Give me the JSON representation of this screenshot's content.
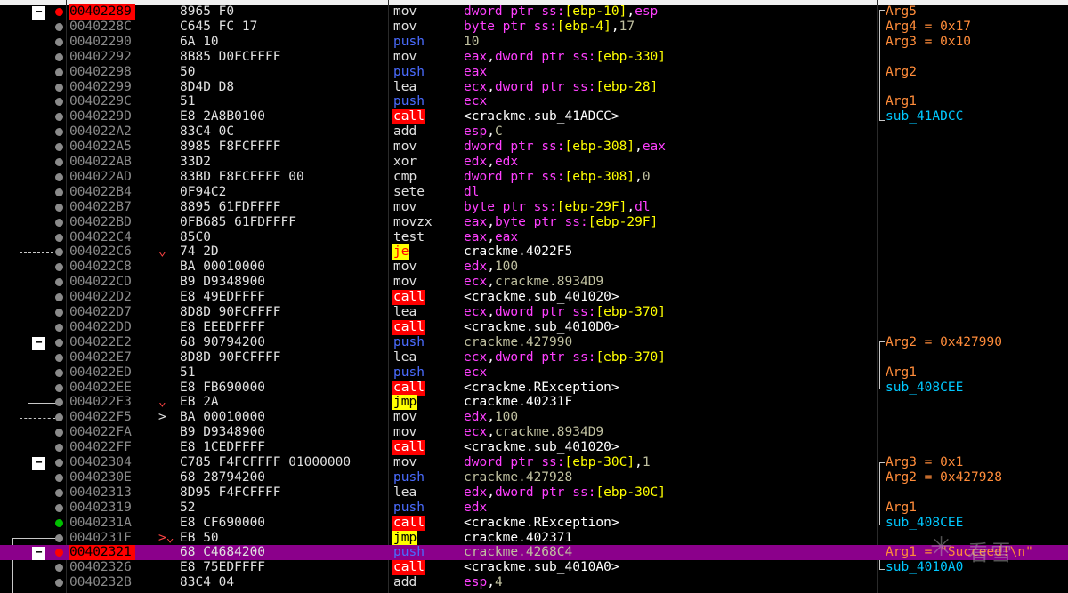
{
  "colors": {
    "background": "#000000",
    "address": "#8a8a8a",
    "eip_bg": "#ff0000",
    "call_bg": "#ff0000",
    "jmp_bg": "#ffff00",
    "push": "#4a6cff",
    "register": "#ff40ff",
    "ptr": "#ff40ff",
    "segment": "#ff40ff",
    "memory_bracket": "#ffff00",
    "immediate": "#c0c0a0",
    "label": "#ffffff",
    "comment_arg": "#ff8c3a",
    "comment_sub": "#00c8ff",
    "selected_row": "#8b008b"
  },
  "rows": [
    {
      "addr": "00402289",
      "bytes": "8965 F0",
      "mn": "mov",
      "op": [
        [
          "dword ptr ",
          "ptr"
        ],
        [
          "ss:",
          "seg"
        ],
        [
          "[ebp-10]",
          "mem"
        ],
        [
          ",",
          "sep"
        ],
        [
          "esp",
          "reg"
        ]
      ],
      "comment": "Arg5",
      "eip": true,
      "dot": "red",
      "collapse": true
    },
    {
      "addr": "0040228C",
      "bytes": "C645 FC 17",
      "mn": "mov",
      "op": [
        [
          "byte ptr ",
          "ptr"
        ],
        [
          "ss:",
          "seg"
        ],
        [
          "[ebp-4]",
          "mem"
        ],
        [
          ",",
          "sep"
        ],
        [
          "17",
          "imm"
        ]
      ],
      "comment": "Arg4 = 0x17"
    },
    {
      "addr": "00402290",
      "bytes": "6A 10",
      "mn": "push",
      "op": [
        [
          "10",
          "imm"
        ]
      ],
      "comment": "Arg3 = 0x10"
    },
    {
      "addr": "00402292",
      "bytes": "8B85 D0FCFFFF",
      "mn": "mov",
      "op": [
        [
          "eax",
          "reg"
        ],
        [
          ",",
          "sep"
        ],
        [
          "dword ptr ",
          "ptr"
        ],
        [
          "ss:",
          "seg"
        ],
        [
          "[ebp-330]",
          "mem"
        ]
      ],
      "comment": ""
    },
    {
      "addr": "00402298",
      "bytes": "50",
      "mn": "push",
      "op": [
        [
          "eax",
          "reg"
        ]
      ],
      "comment": "Arg2"
    },
    {
      "addr": "00402299",
      "bytes": "8D4D D8",
      "mn": "lea",
      "op": [
        [
          "ecx",
          "reg"
        ],
        [
          ",",
          "sep"
        ],
        [
          "dword ptr ",
          "ptr"
        ],
        [
          "ss:",
          "seg"
        ],
        [
          "[ebp-28]",
          "mem"
        ]
      ],
      "comment": ""
    },
    {
      "addr": "0040229C",
      "bytes": "51",
      "mn": "push",
      "op": [
        [
          "ecx",
          "reg"
        ]
      ],
      "comment": "Arg1"
    },
    {
      "addr": "0040229D",
      "bytes": "E8 2A8B0100",
      "mn": "call",
      "op": [
        [
          "<crackme.sub_41ADCC>",
          "lbl"
        ]
      ],
      "comment": "sub_41ADCC",
      "sub": true
    },
    {
      "addr": "004022A2",
      "bytes": "83C4 0C",
      "mn": "add",
      "op": [
        [
          "esp",
          "reg"
        ],
        [
          ",",
          "sep"
        ],
        [
          "C",
          "imm"
        ]
      ],
      "comment": ""
    },
    {
      "addr": "004022A5",
      "bytes": "8985 F8FCFFFF",
      "mn": "mov",
      "op": [
        [
          "dword ptr ",
          "ptr"
        ],
        [
          "ss:",
          "seg"
        ],
        [
          "[ebp-308]",
          "mem"
        ],
        [
          ",",
          "sep"
        ],
        [
          "eax",
          "reg"
        ]
      ],
      "comment": ""
    },
    {
      "addr": "004022AB",
      "bytes": "33D2",
      "mn": "xor",
      "op": [
        [
          "edx",
          "reg"
        ],
        [
          ",",
          "sep"
        ],
        [
          "edx",
          "reg"
        ]
      ],
      "comment": ""
    },
    {
      "addr": "004022AD",
      "bytes": "83BD F8FCFFFF 00",
      "mn": "cmp",
      "op": [
        [
          "dword ptr ",
          "ptr"
        ],
        [
          "ss:",
          "seg"
        ],
        [
          "[ebp-308]",
          "mem"
        ],
        [
          ",",
          "sep"
        ],
        [
          "0",
          "imm"
        ]
      ],
      "comment": ""
    },
    {
      "addr": "004022B4",
      "bytes": "0F94C2",
      "mn": "sete",
      "op": [
        [
          "dl",
          "reg"
        ]
      ],
      "comment": ""
    },
    {
      "addr": "004022B7",
      "bytes": "8895 61FDFFFF",
      "mn": "mov",
      "op": [
        [
          "byte ptr ",
          "ptr"
        ],
        [
          "ss:",
          "seg"
        ],
        [
          "[ebp-29F]",
          "mem"
        ],
        [
          ",",
          "sep"
        ],
        [
          "dl",
          "reg"
        ]
      ],
      "comment": ""
    },
    {
      "addr": "004022BD",
      "bytes": "0FB685 61FDFFFF",
      "mn": "movzx",
      "op": [
        [
          "eax",
          "reg"
        ],
        [
          ",",
          "sep"
        ],
        [
          "byte ptr ",
          "ptr"
        ],
        [
          "ss:",
          "seg"
        ],
        [
          "[ebp-29F]",
          "mem"
        ]
      ],
      "comment": ""
    },
    {
      "addr": "004022C4",
      "bytes": "85C0",
      "mn": "test",
      "op": [
        [
          "eax",
          "reg"
        ],
        [
          ",",
          "sep"
        ],
        [
          "eax",
          "reg"
        ]
      ],
      "comment": ""
    },
    {
      "addr": "004022C6",
      "bytes": "74 2D",
      "mn": "je",
      "op": [
        [
          "crackme.4022F5",
          "lbl"
        ]
      ],
      "comment": "",
      "mark": "⌄"
    },
    {
      "addr": "004022C8",
      "bytes": "BA 00010000",
      "mn": "mov",
      "op": [
        [
          "edx",
          "reg"
        ],
        [
          ",",
          "sep"
        ],
        [
          "100",
          "imm"
        ]
      ],
      "comment": ""
    },
    {
      "addr": "004022CD",
      "bytes": "B9 D9348900",
      "mn": "mov",
      "op": [
        [
          "ecx",
          "reg"
        ],
        [
          ",",
          "sep"
        ],
        [
          "crackme.8934D9",
          "imm"
        ]
      ],
      "comment": ""
    },
    {
      "addr": "004022D2",
      "bytes": "E8 49EDFFFF",
      "mn": "call",
      "op": [
        [
          "<crackme.sub_401020>",
          "lbl"
        ]
      ],
      "comment": ""
    },
    {
      "addr": "004022D7",
      "bytes": "8D8D 90FCFFFF",
      "mn": "lea",
      "op": [
        [
          "ecx",
          "reg"
        ],
        [
          ",",
          "sep"
        ],
        [
          "dword ptr ",
          "ptr"
        ],
        [
          "ss:",
          "seg"
        ],
        [
          "[ebp-370]",
          "mem"
        ]
      ],
      "comment": ""
    },
    {
      "addr": "004022DD",
      "bytes": "E8 EEEDFFFF",
      "mn": "call",
      "op": [
        [
          "<crackme.sub_4010D0>",
          "lbl"
        ]
      ],
      "comment": ""
    },
    {
      "addr": "004022E2",
      "bytes": "68 90794200",
      "mn": "push",
      "op": [
        [
          "crackme.427990",
          "imm"
        ]
      ],
      "comment": "Arg2 = 0x427990",
      "collapse": true
    },
    {
      "addr": "004022E7",
      "bytes": "8D8D 90FCFFFF",
      "mn": "lea",
      "op": [
        [
          "ecx",
          "reg"
        ],
        [
          ",",
          "sep"
        ],
        [
          "dword ptr ",
          "ptr"
        ],
        [
          "ss:",
          "seg"
        ],
        [
          "[ebp-370]",
          "mem"
        ]
      ],
      "comment": ""
    },
    {
      "addr": "004022ED",
      "bytes": "51",
      "mn": "push",
      "op": [
        [
          "ecx",
          "reg"
        ]
      ],
      "comment": "Arg1"
    },
    {
      "addr": "004022EE",
      "bytes": "E8 FB690000",
      "mn": "call",
      "op": [
        [
          "<crackme.RException>",
          "lbl"
        ]
      ],
      "comment": "sub_408CEE",
      "sub": true
    },
    {
      "addr": "004022F3",
      "bytes": "EB 2A",
      "mn": "jmp",
      "op": [
        [
          "crackme.40231F",
          "lbl"
        ]
      ],
      "comment": "",
      "mark": "⌄"
    },
    {
      "addr": "004022F5",
      "bytes": "BA 00010000",
      "mn": "mov",
      "op": [
        [
          "edx",
          "reg"
        ],
        [
          ",",
          "sep"
        ],
        [
          "100",
          "imm"
        ]
      ],
      "comment": "",
      "mark": ">",
      "markw": true
    },
    {
      "addr": "004022FA",
      "bytes": "B9 D9348900",
      "mn": "mov",
      "op": [
        [
          "ecx",
          "reg"
        ],
        [
          ",",
          "sep"
        ],
        [
          "crackme.8934D9",
          "imm"
        ]
      ],
      "comment": ""
    },
    {
      "addr": "004022FF",
      "bytes": "E8 1CEDFFFF",
      "mn": "call",
      "op": [
        [
          "<crackme.sub_401020>",
          "lbl"
        ]
      ],
      "comment": ""
    },
    {
      "addr": "00402304",
      "bytes": "C785 F4FCFFFF 01000000",
      "mn": "mov",
      "op": [
        [
          "dword ptr ",
          "ptr"
        ],
        [
          "ss:",
          "seg"
        ],
        [
          "[ebp-30C]",
          "mem"
        ],
        [
          ",",
          "sep"
        ],
        [
          "1",
          "imm"
        ]
      ],
      "comment": "Arg3 = 0x1",
      "collapse": true
    },
    {
      "addr": "0040230E",
      "bytes": "68 28794200",
      "mn": "push",
      "op": [
        [
          "crackme.427928",
          "imm"
        ]
      ],
      "comment": "Arg2 = 0x427928"
    },
    {
      "addr": "00402313",
      "bytes": "8D95 F4FCFFFF",
      "mn": "lea",
      "op": [
        [
          "edx",
          "reg"
        ],
        [
          ",",
          "sep"
        ],
        [
          "dword ptr ",
          "ptr"
        ],
        [
          "ss:",
          "seg"
        ],
        [
          "[ebp-30C]",
          "mem"
        ]
      ],
      "comment": ""
    },
    {
      "addr": "00402319",
      "bytes": "52",
      "mn": "push",
      "op": [
        [
          "edx",
          "reg"
        ]
      ],
      "comment": "Arg1"
    },
    {
      "addr": "0040231A",
      "bytes": "E8 CF690000",
      "mn": "call",
      "op": [
        [
          "<crackme.RException>",
          "lbl"
        ]
      ],
      "comment": "sub_408CEE",
      "sub": true,
      "dot": "green"
    },
    {
      "addr": "0040231F",
      "bytes": "EB 50",
      "mn": "jmp",
      "op": [
        [
          "crackme.402371",
          "lbl"
        ]
      ],
      "comment": "",
      "mark": ">⌄"
    },
    {
      "addr": "00402321",
      "bytes": "68 C4684200",
      "mn": "push",
      "op": [
        [
          "crackme.4268C4",
          "imm"
        ]
      ],
      "comment": "Arg1 = \"Succeed!\\n\"",
      "eip": true,
      "dot": "red",
      "collapse": true,
      "selected": true
    },
    {
      "addr": "00402326",
      "bytes": "E8 75EDFFFF",
      "mn": "call",
      "op": [
        [
          "<crackme.sub_4010A0>",
          "lbl"
        ]
      ],
      "comment": "sub_4010A0",
      "sub": true
    },
    {
      "addr": "0040232B",
      "bytes": "83C4 04",
      "mn": "add",
      "op": [
        [
          "esp",
          "reg"
        ],
        [
          ",",
          "sep"
        ],
        [
          "4",
          "imm"
        ]
      ],
      "comment": ""
    }
  ],
  "watermark": {
    "symbol": "✳",
    "text": "看雪"
  }
}
